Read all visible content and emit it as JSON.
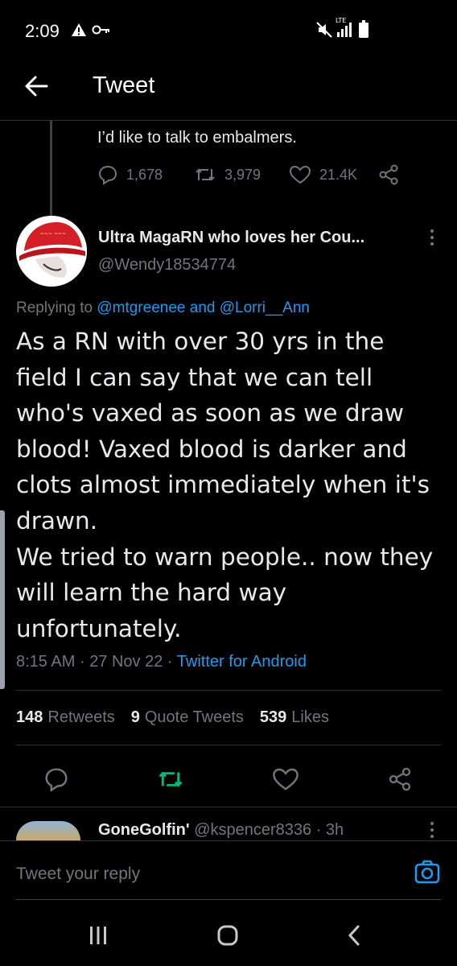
{
  "status_bar": {
    "time": "2:09",
    "network": "LTE",
    "icons": [
      "warning-icon",
      "key-icon",
      "mute-icon",
      "signal-icon",
      "battery-icon"
    ]
  },
  "header": {
    "title": "Tweet",
    "back_icon": "arrow-left-icon"
  },
  "previous_tweet": {
    "text": "I’d like to talk to embalmers.",
    "replies": "1,678",
    "retweets": "3,979",
    "likes": "21.4K"
  },
  "tweet": {
    "author_name": "Ultra MagaRN who loves her Cou...",
    "author_handle": "@Wendy18534774",
    "replying_prefix": "Replying to",
    "replying_to_1": "@mtgreenee",
    "replying_and": "and",
    "replying_to_2": "@Lorri__Ann",
    "text": "As a RN with over 30 yrs in the field I can say that we can tell who's vaxed as soon as we draw blood! Vaxed blood is darker and clots almost immediately when it's drawn.\nWe tried to warn people.. now they will learn the hard way unfortunately.",
    "time": "8:15 AM",
    "date": "27 Nov 22",
    "separator": "·",
    "source": "Twitter for Android"
  },
  "stats": {
    "retweets_count": "148",
    "retweets_label": "Retweets",
    "quotes_count": "9",
    "quotes_label": "Quote Tweets",
    "likes_count": "539",
    "likes_label": "Likes"
  },
  "next_reply": {
    "name": "GoneGolfin'",
    "handle": "@kspencer8336 · 3h"
  },
  "compose": {
    "placeholder": "Tweet your reply"
  },
  "colors": {
    "background": "#000000",
    "text": "#e7e9ea",
    "muted": "#71767b",
    "accent": "#1d9bf0",
    "retweet_active": "#00ba7c"
  }
}
